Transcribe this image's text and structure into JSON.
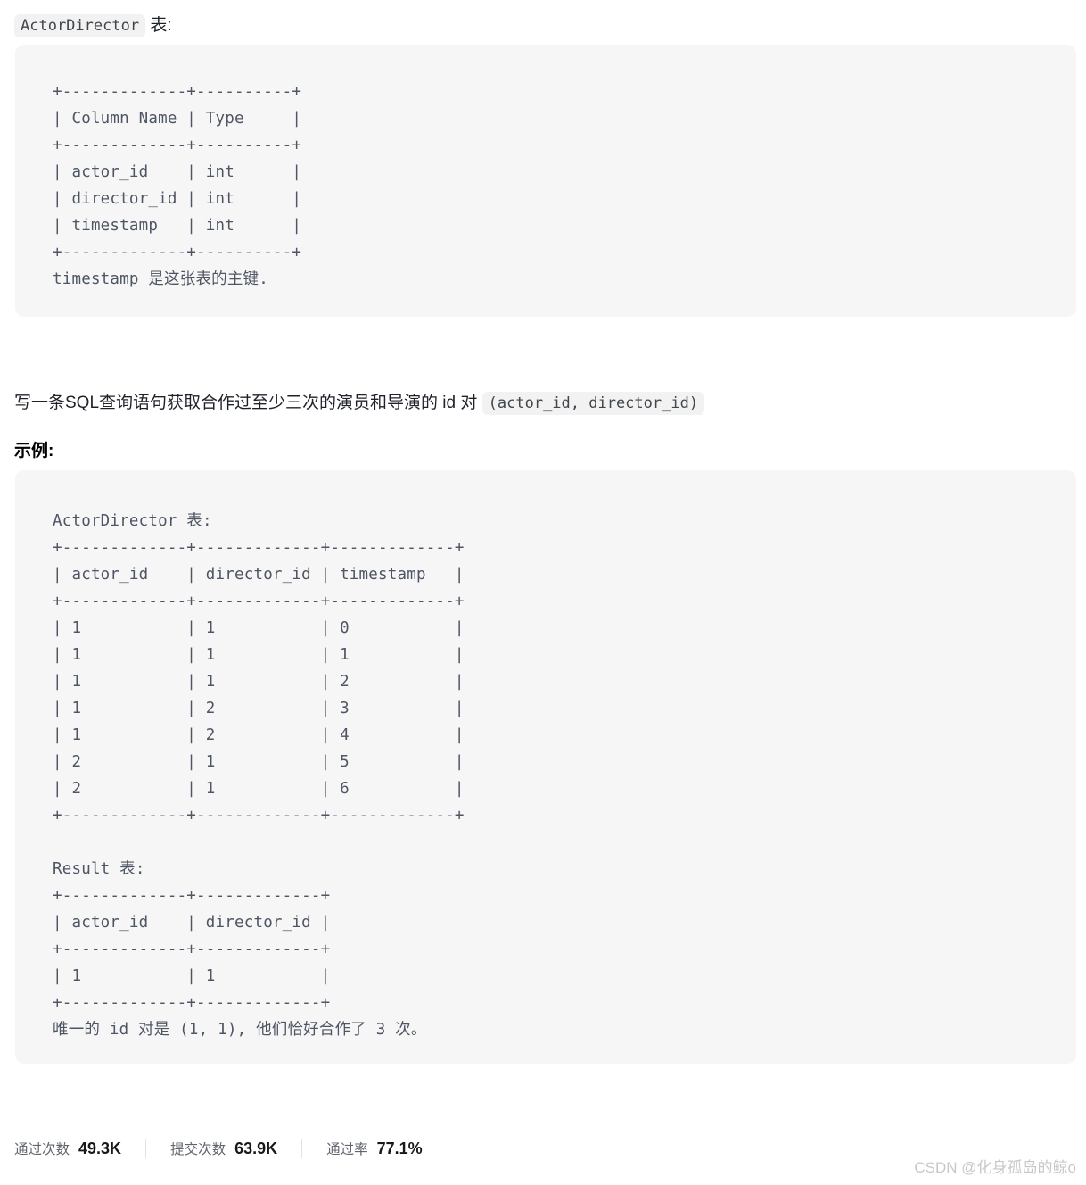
{
  "intro": {
    "table_name": "ActorDirector",
    "suffix": " 表:"
  },
  "schema_block": {
    "text": "+-------------+----------+\n| Column Name | Type     |\n+-------------+----------+\n| actor_id    | int      |\n| director_id | int      |\n| timestamp   | int      |\n+-------------+----------+\ntimestamp 是这张表的主键."
  },
  "prompt": {
    "text_before": "写一条SQL查询语句获取合作过至少三次的演员和导演的 id 对 ",
    "code": "(actor_id, director_id)"
  },
  "section_title": "示例:",
  "example_block": {
    "text": "ActorDirector 表:\n+-------------+-------------+-------------+\n| actor_id    | director_id | timestamp   |\n+-------------+-------------+-------------+\n| 1           | 1           | 0           |\n| 1           | 1           | 1           |\n| 1           | 1           | 2           |\n| 1           | 2           | 3           |\n| 1           | 2           | 4           |\n| 2           | 1           | 5           |\n| 2           | 1           | 6           |\n+-------------+-------------+-------------+\n\nResult 表:\n+-------------+-------------+\n| actor_id    | director_id |\n+-------------+-------------+\n| 1           | 1           |\n+-------------+-------------+\n唯一的 id 对是 (1, 1), 他们恰好合作了 3 次。"
  },
  "stats": [
    {
      "label": "通过次数",
      "value": "49.3K"
    },
    {
      "label": "提交次数",
      "value": "63.9K"
    },
    {
      "label": "通过率",
      "value": "77.1%"
    }
  ],
  "watermark": "CSDN @化身孤岛的鲸o",
  "colors": {
    "code_block_bg": "#f6f6f7",
    "inline_code_bg": "#f2f2f3",
    "code_text": "#4e5563",
    "body_text": "#1f2329",
    "watermark": "#c6c8cc",
    "divider": "#e2e3e5"
  }
}
